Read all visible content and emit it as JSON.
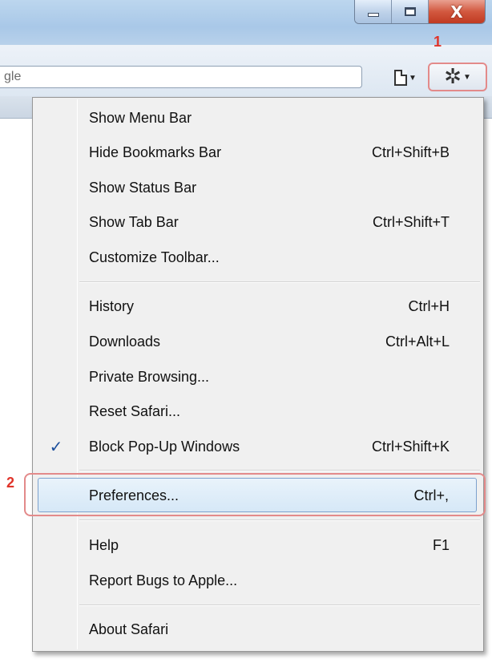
{
  "window": {
    "minimize_icon": "minimize-icon",
    "maximize_icon": "maximize-icon",
    "close_icon": "close-icon",
    "close_glyph": "X"
  },
  "toolbar": {
    "address_value": "gle",
    "page_icon": "page-icon",
    "settings_icon": "gear-icon"
  },
  "annotations": {
    "step1": "1",
    "step2": "2"
  },
  "menu": {
    "items": [
      {
        "label": "Show Menu Bar",
        "shortcut": ""
      },
      {
        "label": "Hide Bookmarks Bar",
        "shortcut": "Ctrl+Shift+B"
      },
      {
        "label": "Show Status Bar",
        "shortcut": ""
      },
      {
        "label": "Show Tab Bar",
        "shortcut": "Ctrl+Shift+T"
      },
      {
        "label": "Customize Toolbar...",
        "shortcut": ""
      },
      {
        "label": "History",
        "shortcut": "Ctrl+H"
      },
      {
        "label": "Downloads",
        "shortcut": "Ctrl+Alt+L"
      },
      {
        "label": "Private Browsing...",
        "shortcut": ""
      },
      {
        "label": "Reset Safari...",
        "shortcut": ""
      },
      {
        "label": "Block Pop-Up Windows",
        "shortcut": "Ctrl+Shift+K",
        "checked": true,
        "check_glyph": "✓"
      },
      {
        "label": "Preferences...",
        "shortcut": "Ctrl+,",
        "highlighted": true
      },
      {
        "label": "Help",
        "shortcut": "F1"
      },
      {
        "label": "Report Bugs to Apple...",
        "shortcut": ""
      },
      {
        "label": "About Safari",
        "shortcut": ""
      }
    ]
  },
  "colors": {
    "annotation": "#e0342a",
    "check": "#1c4f9c",
    "highlight_border": "#7da2ce"
  }
}
